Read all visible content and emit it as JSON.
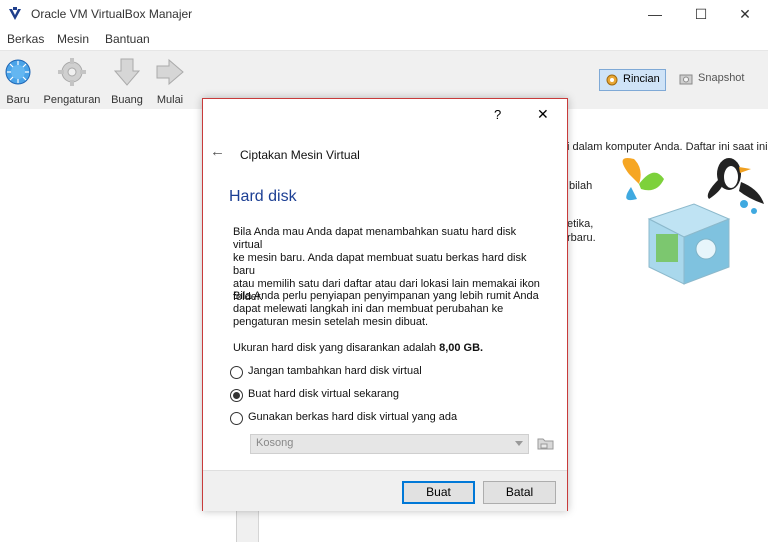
{
  "window": {
    "title": "Oracle VM VirtualBox Manajer",
    "min_glyph": "—",
    "max_glyph": "☐",
    "close_glyph": "✕"
  },
  "menu": {
    "items": [
      "Berkas",
      "Mesin",
      "Bantuan"
    ]
  },
  "toolbar": {
    "new_label": "Baru",
    "settings_label": "Pengaturan",
    "discard_label": "Buang",
    "start_label": "Mulai",
    "details_label": "Rincian",
    "snapshot_label": "Snapshot"
  },
  "welcome": {
    "line1": "i dalam komputer Anda. Daftar ini saat ini",
    "line2": "bilah",
    "line3": "etika,",
    "line4": "rbaru."
  },
  "dialog": {
    "help_glyph": "?",
    "close_glyph": "✕",
    "back_glyph": "←",
    "wizard_title": "Ciptakan Mesin Virtual",
    "page_title": "Hard disk",
    "para1_line1": "Bila Anda mau Anda dapat menambahkan suatu hard disk virtual",
    "para1_line2": "ke mesin baru. Anda dapat membuat suatu berkas hard disk baru",
    "para1_line3": "atau memilih satu dari daftar atau dari lokasi lain memakai ikon",
    "para1_line4": "folder.",
    "para2_line1": "Bila Anda perlu penyiapan penyimpanan yang lebih rumit Anda",
    "para2_line2": "dapat melewati langkah ini dan membuat perubahan ke",
    "para2_line3": "pengaturan mesin setelah mesin dibuat.",
    "recommend_prefix": "Ukuran hard disk yang disarankan adalah ",
    "recommend_size": "8,00 GB.",
    "option_none": "Jangan tambahkan hard disk virtual",
    "option_create": "Buat hard disk virtual sekarang",
    "option_existing": "Gunakan berkas hard disk virtual yang ada",
    "combo_value": "Kosong",
    "create_button": "Buat",
    "cancel_button": "Batal"
  }
}
